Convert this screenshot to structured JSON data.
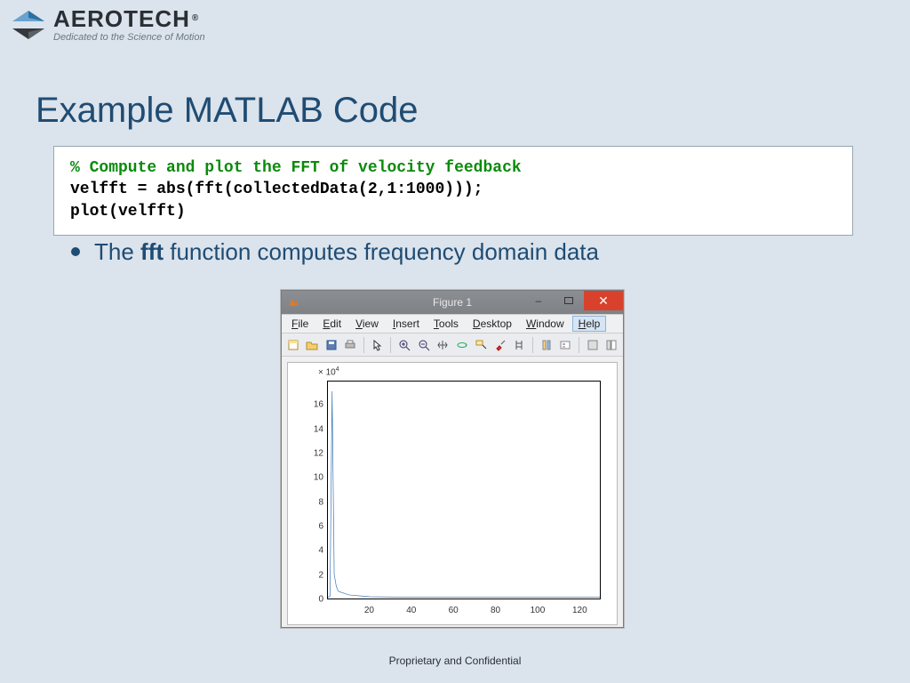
{
  "logo": {
    "word": "AEROTECH",
    "registered": "®",
    "tagline": "Dedicated to the Science of Motion"
  },
  "slide": {
    "title": "Example MATLAB Code",
    "bullet_prefix": "The ",
    "bullet_bold": "fft",
    "bullet_suffix": " function computes frequency domain data"
  },
  "code": {
    "comment": "% Compute and plot the FFT of velocity feedback",
    "line1": "velfft = abs(fft(collectedData(2,1:1000)));",
    "line2": "plot(velfft)"
  },
  "figure": {
    "title": "Figure 1",
    "menu": [
      "File",
      "Edit",
      "View",
      "Insert",
      "Tools",
      "Desktop",
      "Window",
      "Help"
    ],
    "menu_underline_index": [
      0,
      0,
      0,
      0,
      0,
      0,
      0,
      0
    ],
    "selected_menu": 7
  },
  "chart_data": {
    "type": "line",
    "title": "",
    "xlabel": "",
    "ylabel": "",
    "x_ticks": [
      20,
      40,
      60,
      80,
      100,
      120
    ],
    "y_ticks": [
      0,
      2,
      4,
      6,
      8,
      10,
      12,
      14,
      16
    ],
    "y_exponent": "× 10⁴",
    "xlim": [
      0,
      130
    ],
    "ylim": [
      0,
      18
    ],
    "series": [
      {
        "name": "velfft",
        "x": [
          0,
          1,
          2,
          3,
          4,
          5,
          10,
          20,
          40,
          60,
          80,
          100,
          120,
          130
        ],
        "y": [
          0.1,
          0.2,
          17.2,
          2.0,
          1.0,
          0.6,
          0.3,
          0.15,
          0.1,
          0.1,
          0.1,
          0.1,
          0.1,
          0.1
        ]
      }
    ]
  },
  "footer": "Proprietary and Confidential"
}
